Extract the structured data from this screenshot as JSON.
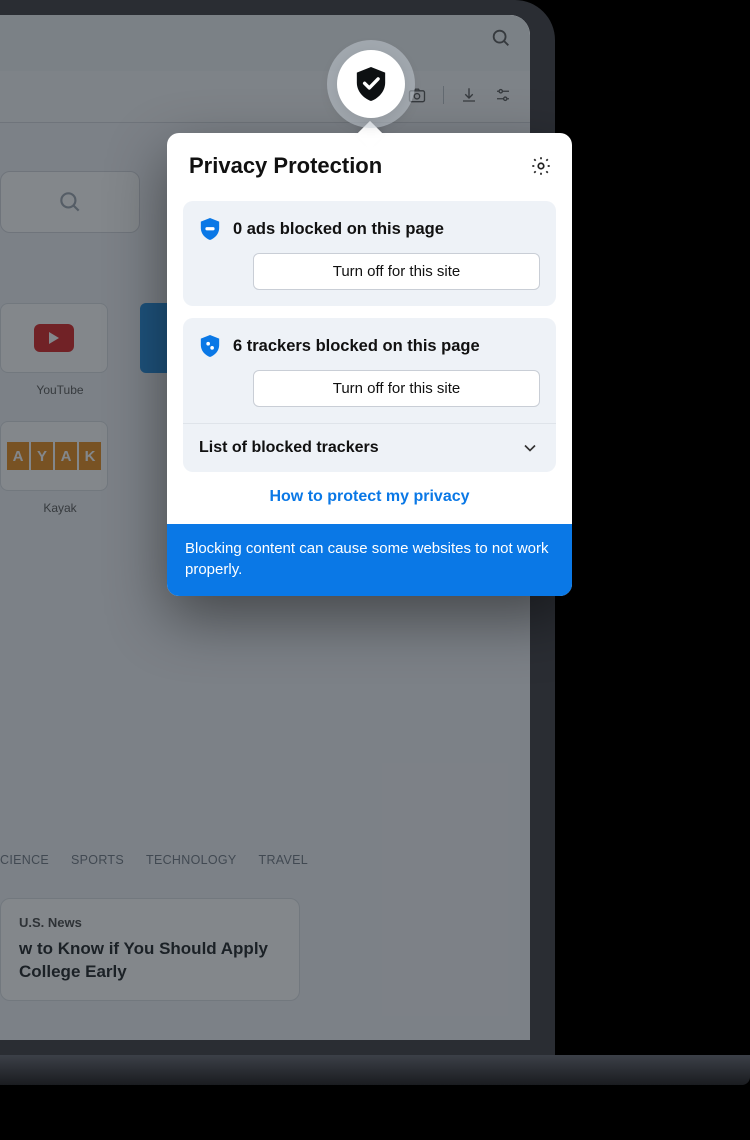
{
  "panel": {
    "title": "Privacy Protection",
    "ads": {
      "count": 0,
      "text": "0 ads blocked on this page",
      "button": "Turn off for this site"
    },
    "trackers": {
      "count": 6,
      "text": "6 trackers blocked on this page",
      "button": "Turn off for this site"
    },
    "list_label": "List of blocked trackers",
    "help_link": "How to protect my privacy",
    "warning": "Blocking content can cause some websites to not work properly."
  },
  "background": {
    "tiles": [
      {
        "label": "YouTube"
      },
      {
        "label": "Kayak"
      }
    ],
    "categories": [
      "CIENCE",
      "SPORTS",
      "TECHNOLOGY",
      "TRAVEL"
    ],
    "news": {
      "eyebrow": "U.S. News",
      "headline": "w to Know if You Should Apply College Early"
    }
  }
}
